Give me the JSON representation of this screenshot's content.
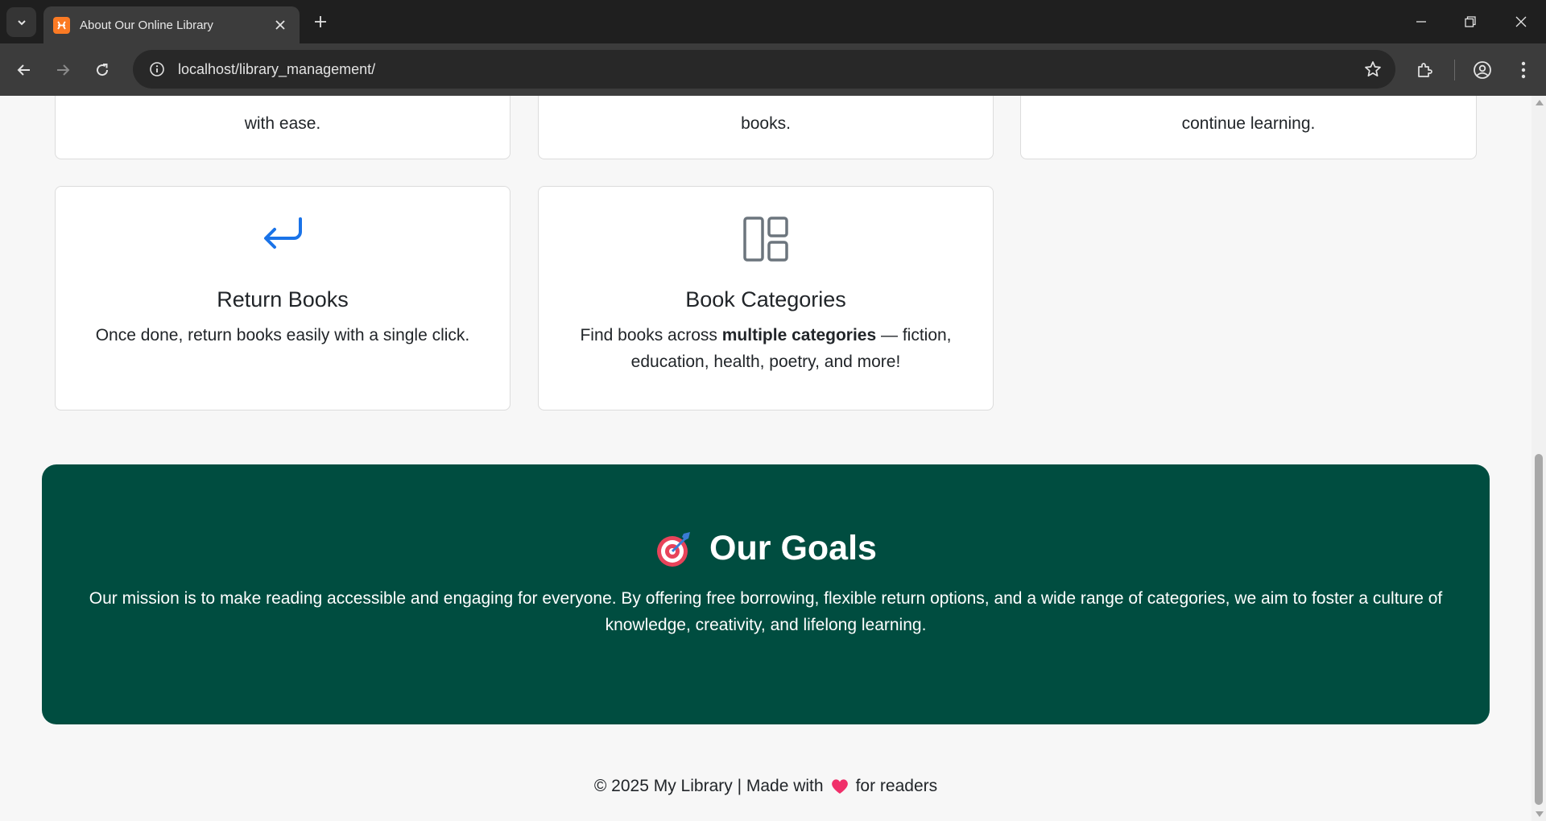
{
  "browser": {
    "tab_title": "About Our Online Library",
    "url": "localhost/library_management/"
  },
  "cards_top": [
    {
      "text": "with ease."
    },
    {
      "text": "books."
    },
    {
      "text": "continue learning."
    }
  ],
  "cards": [
    {
      "icon": "return-arrow-icon",
      "title": "Return Books",
      "text": "Once done, return books easily with a single click."
    },
    {
      "icon": "layout-grid-icon",
      "title": "Book Categories",
      "text_before": "Find books across",
      "text_bold": "multiple categories",
      "text_after": "— fiction, education, health, poetry, and more!"
    }
  ],
  "goals": {
    "icon": "target-dart-icon",
    "title": "Our Goals",
    "text": "Our mission is to make reading accessible and engaging for everyone. By offering free borrowing, flexible return options, and a wide range of categories, we aim to foster a culture of knowledge, creativity, and lifelong learning."
  },
  "footer": {
    "text_before": "© 2025 My Library | Made with",
    "heart_icon": "heart-icon",
    "text_after": "for readers"
  },
  "colors": {
    "goals_bg": "#004d40",
    "return_icon": "#1a73e8",
    "categories_icon": "#6c757d"
  }
}
